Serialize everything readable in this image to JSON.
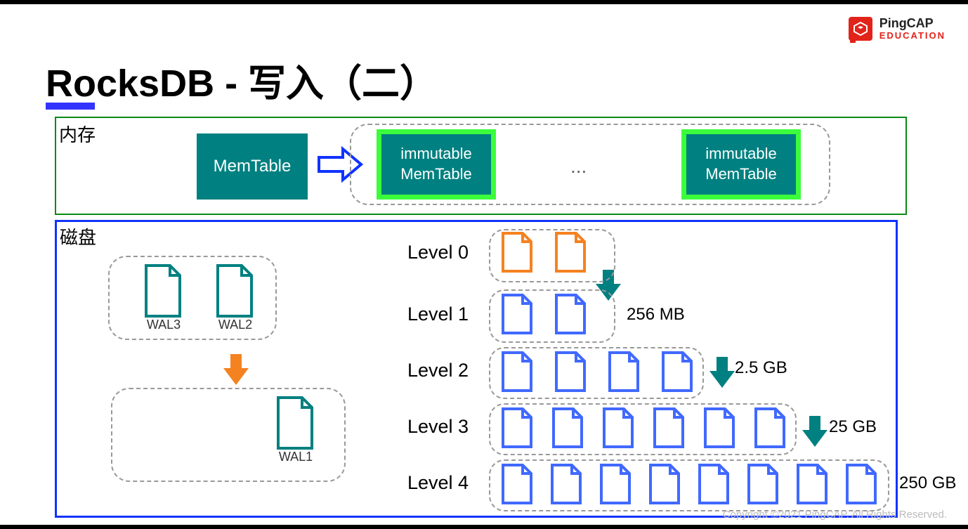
{
  "header": {
    "brand": "PingCAP",
    "subbrand": "EDUCATION"
  },
  "title": "RocksDB - 写入（二）",
  "memory": {
    "label": "内存",
    "memtable": "MemTable",
    "immutable_line1": "immutable",
    "immutable_line2": "MemTable",
    "ellipsis": "..."
  },
  "disk": {
    "label": "磁盘",
    "wal": {
      "wal1": "WAL1",
      "wal2": "WAL2",
      "wal3": "WAL3"
    },
    "levels": {
      "l0": "Level 0",
      "l1": "Level 1",
      "l2": "Level 2",
      "l3": "Level 3",
      "l4": "Level 4"
    },
    "sizes": {
      "l1": "256 MB",
      "l2": "2.5 GB",
      "l3": "25 GB",
      "l4": "250 GB"
    }
  },
  "footer": {
    "copyright": "Copyright ©2021 PingCAP. All Rights Reserved."
  }
}
